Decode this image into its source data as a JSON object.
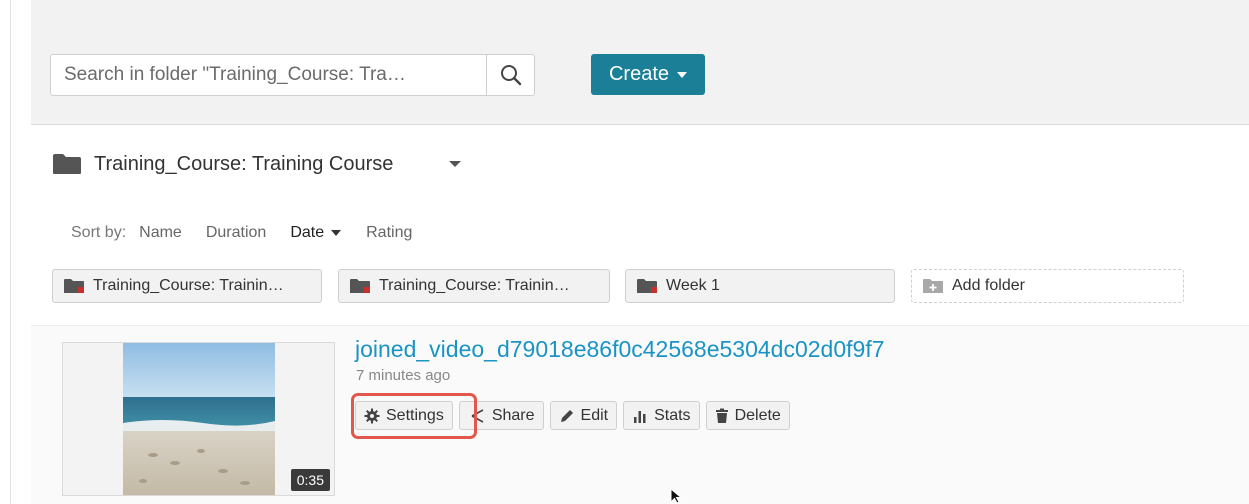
{
  "search": {
    "placeholder": "Search in folder \"Training_Course: Tra…",
    "button_icon": "search-icon"
  },
  "toolbar": {
    "create_label": "Create"
  },
  "folder": {
    "title": "Training_Course: Training Course",
    "icon": "folder-icon"
  },
  "sort": {
    "label": "Sort by:",
    "options": [
      "Name",
      "Duration",
      "Date",
      "Rating"
    ],
    "active": "Date"
  },
  "subfolders": [
    {
      "label": "Training_Course: Trainin…"
    },
    {
      "label": "Training_Course: Trainin…"
    },
    {
      "label": "Week 1"
    }
  ],
  "add_folder": {
    "label": "Add folder"
  },
  "entry": {
    "title": "joined_video_d79018e86f0c42568e5304dc02d0f9f7",
    "time_ago": "7 minutes ago",
    "duration": "0:35",
    "actions": {
      "settings": "Settings",
      "share": "Share",
      "edit": "Edit",
      "stats": "Stats",
      "delete": "Delete"
    }
  },
  "colors": {
    "accent": "#1b7f97",
    "link": "#1a94c4",
    "highlight": "#e2574c"
  }
}
